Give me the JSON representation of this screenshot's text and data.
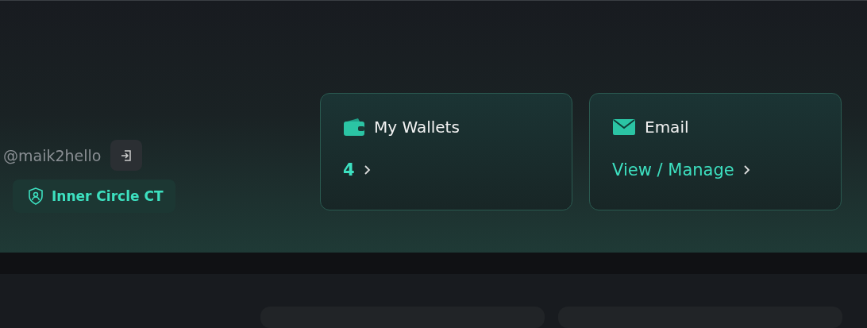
{
  "profile": {
    "username": "@maik2hello",
    "badge": "Inner Circle CT"
  },
  "cards": [
    {
      "kind": "count",
      "title": "My Wallets",
      "value": "4"
    },
    {
      "kind": "link",
      "title": "Email",
      "value": "View / Manage"
    }
  ]
}
